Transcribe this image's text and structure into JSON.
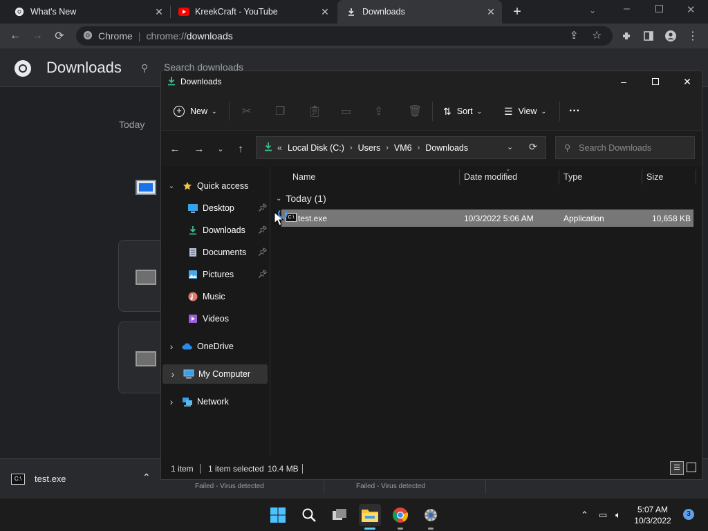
{
  "browser": {
    "tabs": [
      {
        "label": "What's New",
        "icon": "chrome-icon"
      },
      {
        "label": "KreekCraft - YouTube",
        "icon": "youtube-icon"
      },
      {
        "label": "Downloads",
        "icon": "download-icon"
      }
    ],
    "omnibox": {
      "chip": "Chrome",
      "url_prefix": "chrome://",
      "url_path": "downloads"
    }
  },
  "downloads_page": {
    "title": "Downloads",
    "search_placeholder": "Search downloads",
    "today_label": "Today",
    "failed_status": "Failed - Virus detected",
    "failed_status_2": "Failed - Virus detected"
  },
  "shelf": {
    "file_name": "test.exe"
  },
  "explorer": {
    "title": "Downloads",
    "commands": {
      "new": "New",
      "sort": "Sort",
      "view": "View"
    },
    "address": {
      "crumbs": [
        "Local Disk (C:)",
        "Users",
        "VM6",
        "Downloads"
      ]
    },
    "search_placeholder": "Search Downloads",
    "sidebar": [
      {
        "label": "Quick access",
        "icon": "star-icon",
        "indent": 0,
        "expander": "v",
        "pinned": false
      },
      {
        "label": "Desktop",
        "icon": "desktop-icon",
        "indent": 1,
        "pinned": true
      },
      {
        "label": "Downloads",
        "icon": "download-icon",
        "indent": 1,
        "pinned": true
      },
      {
        "label": "Documents",
        "icon": "document-icon",
        "indent": 1,
        "pinned": true
      },
      {
        "label": "Pictures",
        "icon": "pictures-icon",
        "indent": 1,
        "pinned": true
      },
      {
        "label": "Music",
        "icon": "music-icon",
        "indent": 1,
        "pinned": false
      },
      {
        "label": "Videos",
        "icon": "videos-icon",
        "indent": 1,
        "pinned": false
      },
      {
        "label": "OneDrive",
        "icon": "cloud-icon",
        "indent": 0,
        "expander": ">",
        "pinned": false
      },
      {
        "label": "My Computer",
        "icon": "computer-icon",
        "indent": 0,
        "expander": ">",
        "pinned": false,
        "selected": true
      },
      {
        "label": "Network",
        "icon": "network-icon",
        "indent": 0,
        "expander": ">",
        "pinned": false
      }
    ],
    "columns": [
      "Name",
      "Date modified",
      "Type",
      "Size"
    ],
    "group_label": "Today (1)",
    "files": [
      {
        "name": "test.exe",
        "date": "10/3/2022 5:06 AM",
        "type": "Application",
        "size": "10,658 KB"
      }
    ],
    "status": {
      "count": "1 item",
      "selected": "1 item selected",
      "size": "10.4 MB"
    }
  },
  "taskbar": {
    "time": "5:07 AM",
    "date": "10/3/2022",
    "notifications": "3"
  },
  "colors": {
    "accent": "#60cdff",
    "selection": "#777777",
    "folder": "#f5c542"
  }
}
